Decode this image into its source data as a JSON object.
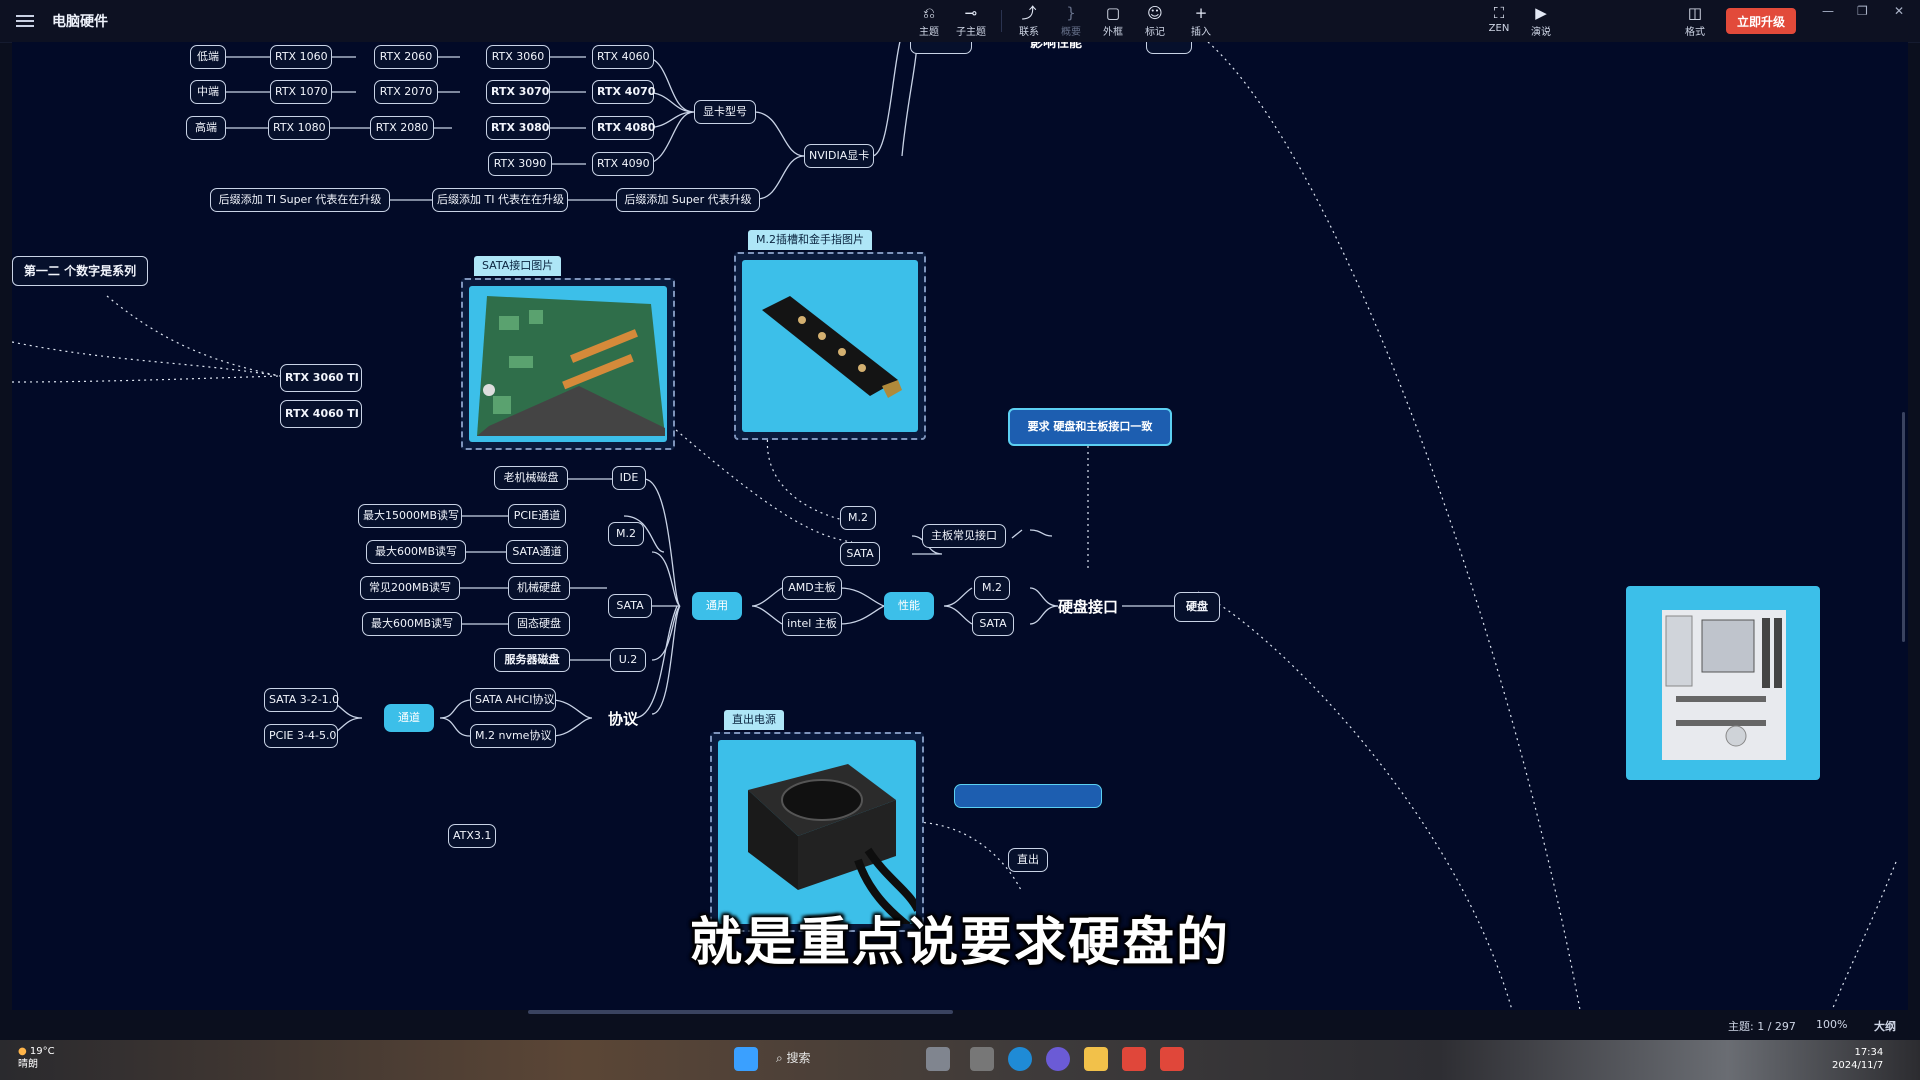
{
  "app": {
    "title": "电脑硬件"
  },
  "toolbar": {
    "items": [
      {
        "label": "主题",
        "icon": "⎌"
      },
      {
        "label": "子主题",
        "icon": "⊸"
      },
      {
        "label": "联系",
        "icon": "⤴"
      },
      {
        "label": "概要",
        "icon": "}"
      },
      {
        "label": "外框",
        "icon": "▢"
      },
      {
        "label": "标记",
        "icon": "☺"
      },
      {
        "label": "插入",
        "icon": "+"
      }
    ],
    "zen": {
      "label": "ZEN",
      "icon": "⛶"
    },
    "present": {
      "label": "演说",
      "icon": "▶"
    },
    "format": {
      "label": "格式",
      "icon": "◫"
    },
    "upgrade": "立即升级"
  },
  "nodes": {
    "low": "低端",
    "mid": "中端",
    "high": "高端",
    "rtx1060": "RTX 1060",
    "rtx1070": "RTX 1070",
    "rtx1080": "RTX 1080",
    "rtx2060": "RTX 2060",
    "rtx2070": "RTX 2070",
    "rtx2080": "RTX 2080",
    "rtx3060": "RTX 3060",
    "rtx3070": "RTX 3070",
    "rtx3080": "RTX 3080",
    "rtx3090": "RTX 3090",
    "rtx4060": "RTX 4060",
    "rtx4070": "RTX 4070",
    "rtx4080": "RTX 4080",
    "rtx4090": "RTX 4090",
    "gpu_model": "显卡型号",
    "nvidia": "NVIDIA显卡",
    "ti_super": "后缀添加 TI Super 代表在在升级",
    "ti": "后缀添加 TI 代表在在升级",
    "super": "后缀添加 Super 代表升级",
    "series_note": "第一二 个数字是系列",
    "rtx3060ti": "RTX 3060 TI",
    "rtx4060ti": "RTX 4060 TI",
    "sata_img_tag": "SATA接口图片",
    "m2_img_tag": "M.2插槽和金手指图片",
    "req": "要求 硬盘和主板接口一致",
    "old_hdd": "老机械磁盘",
    "ide": "IDE",
    "max15000": "最大15000MB读写",
    "pcie_channel": "PCIE通道",
    "m2_a": "M.2",
    "max600_a": "最大600MB读写",
    "sata_channel": "SATA通道",
    "common200": "常见200MB读写",
    "mech_hdd": "机械硬盘",
    "sata_a": "SATA",
    "max600_b": "最大600MB读写",
    "ssd": "固态硬盘",
    "server_disk": "服务器磁盘",
    "u2": "U.2",
    "general": "通用",
    "amd_board": "AMD主板",
    "intel_board": "intel 主板",
    "performance": "性能",
    "m2_b": "M.2",
    "sata_b": "SATA",
    "board_common": "主板常见接口",
    "m2_c": "M.2",
    "sata_c": "SATA",
    "disk_interface": "硬盘接口",
    "hard_disk": "硬盘",
    "sata_ver": "SATA 3-2-1.0",
    "pcie_ver": "PCIE 3-4-5.0",
    "channel": "通道",
    "sata_ahci": "SATA AHCI协议",
    "m2_nvme": "M.2 nvme协议",
    "protocol": "协议",
    "psu_tag": "直出电源",
    "atx31": "ATX3.1",
    "direct_out": "直出",
    "top_perf": "影响性能"
  },
  "subtitle": "就是重点说要求硬盘的",
  "statusbar": {
    "topic_count": "主题: 1 / 297",
    "zoom": "100%",
    "outline": "大纲"
  },
  "taskbar": {
    "temp": "19°C",
    "weather": "晴朗",
    "search": "搜索",
    "time": "17:34",
    "date": "2024/11/7"
  },
  "colors": {
    "canvas": "#020a27",
    "accent": "#3cbfe9",
    "upgrade": "#e24a3a",
    "node_border": "#c9d3e6"
  }
}
